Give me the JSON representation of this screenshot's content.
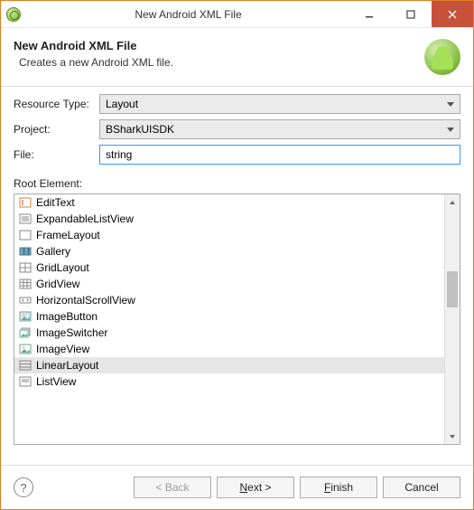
{
  "window": {
    "title": "New Android XML File"
  },
  "header": {
    "title": "New Android XML File",
    "subtitle": "Creates a new Android XML file."
  },
  "form": {
    "resource_type_label": "Resource Type:",
    "resource_type_value": "Layout",
    "project_label": "Project:",
    "project_value": "BSharkUISDK",
    "file_label": "File:",
    "file_value": "string"
  },
  "root_element": {
    "label": "Root Element:",
    "selected": "LinearLayout",
    "items": [
      {
        "label": "EditText",
        "icon": "edit-text-icon"
      },
      {
        "label": "ExpandableListView",
        "icon": "expandable-list-icon"
      },
      {
        "label": "FrameLayout",
        "icon": "frame-layout-icon"
      },
      {
        "label": "Gallery",
        "icon": "gallery-icon"
      },
      {
        "label": "GridLayout",
        "icon": "grid-layout-icon"
      },
      {
        "label": "GridView",
        "icon": "grid-view-icon"
      },
      {
        "label": "HorizontalScrollView",
        "icon": "hscroll-icon"
      },
      {
        "label": "ImageButton",
        "icon": "image-button-icon"
      },
      {
        "label": "ImageSwitcher",
        "icon": "image-switcher-icon"
      },
      {
        "label": "ImageView",
        "icon": "image-view-icon"
      },
      {
        "label": "LinearLayout",
        "icon": "linear-layout-icon"
      },
      {
        "label": "ListView",
        "icon": "list-view-icon"
      }
    ]
  },
  "buttons": {
    "back": "< Back",
    "next": "Next >",
    "finish": "Finish",
    "cancel": "Cancel"
  }
}
